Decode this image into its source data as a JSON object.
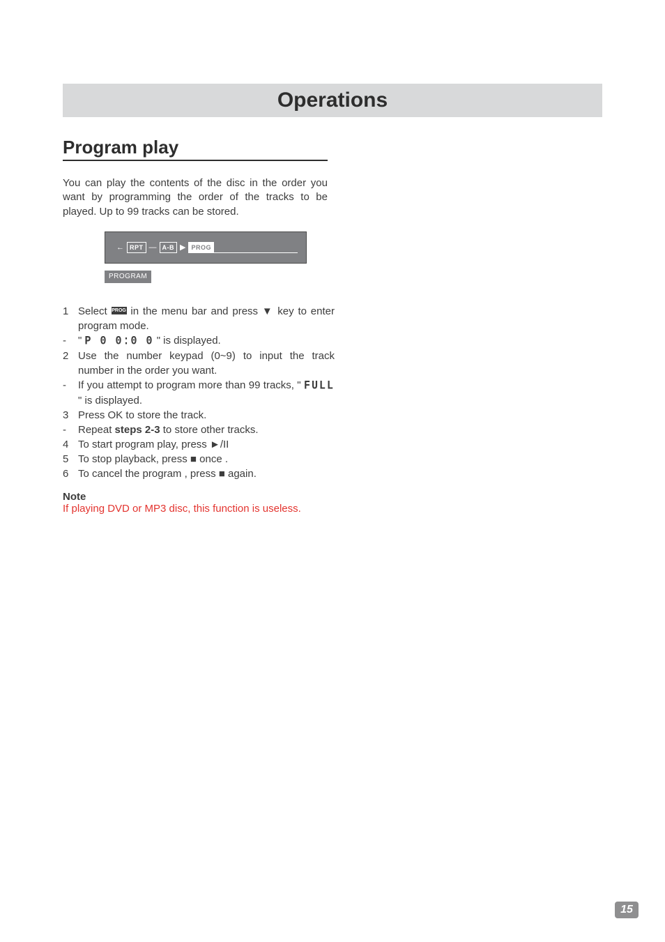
{
  "header": {
    "title": "Operations"
  },
  "section": {
    "heading": "Program play"
  },
  "intro": "You can play the contents of the disc in the order you want  by programming the order of the tracks to be played. Up to 99 tracks can be stored.",
  "diagram": {
    "chips": {
      "rpt": "RPT",
      "ab": "A-B",
      "prog": "PROG"
    },
    "sub": "PROGRAM"
  },
  "steps": [
    {
      "n": "1",
      "pre": "Select ",
      "iconLabel": "PROG",
      "mid": " in the menu bar and press",
      "tail": " key to enter program mode."
    },
    {
      "n": "-",
      "pre": "\" ",
      "seg": "P 0 0:0 0",
      "tail": " \"  is displayed."
    },
    {
      "n": "2",
      "body": "Use the number keypad (0~9) to input the track number in the order you want."
    },
    {
      "n": "-",
      "body_pre": "If you attempt to program more than 99 tracks, \" ",
      "seg": "FULL",
      "body_post": "\"  is displayed."
    },
    {
      "n": "3",
      "body": "Press OK to store the track."
    },
    {
      "n": "-",
      "body_pre": "Repeat ",
      "bold": "steps 2-3",
      "body_post": " to store other tracks."
    },
    {
      "n": "4",
      "body_pre": "To start program play, press ",
      "glyph": "►/II"
    },
    {
      "n": "5",
      "body_pre": "To stop playback, press ",
      "glyph": "■",
      "body_post": " once ."
    },
    {
      "n": "6",
      "body_pre": "To cancel the program , press ",
      "glyph": "■",
      "body_post": "  again."
    }
  ],
  "note": {
    "head": "Note",
    "body": "If playing DVD or MP3 disc, this function is useless."
  },
  "pageNumber": "15"
}
